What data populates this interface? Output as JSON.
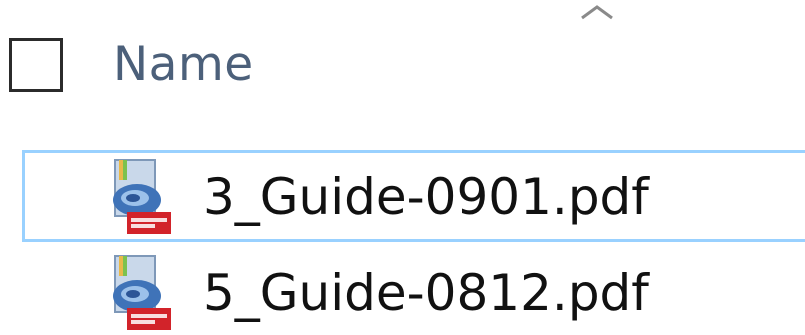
{
  "header": {
    "sort_direction_icon": "chevron-up-icon",
    "select_all_checked": false,
    "name_column_label": "Name"
  },
  "files": [
    {
      "name": "3_Guide-0901.pdf",
      "icon": "pdf-file-icon",
      "focused": true
    },
    {
      "name": "5_Guide-0812.pdf",
      "icon": "pdf-file-icon",
      "focused": false
    }
  ],
  "colors": {
    "header_text": "#4c607a",
    "focus_border": "#99d1ff",
    "file_text": "#111111",
    "checkbox_border": "#2b2b2b"
  }
}
